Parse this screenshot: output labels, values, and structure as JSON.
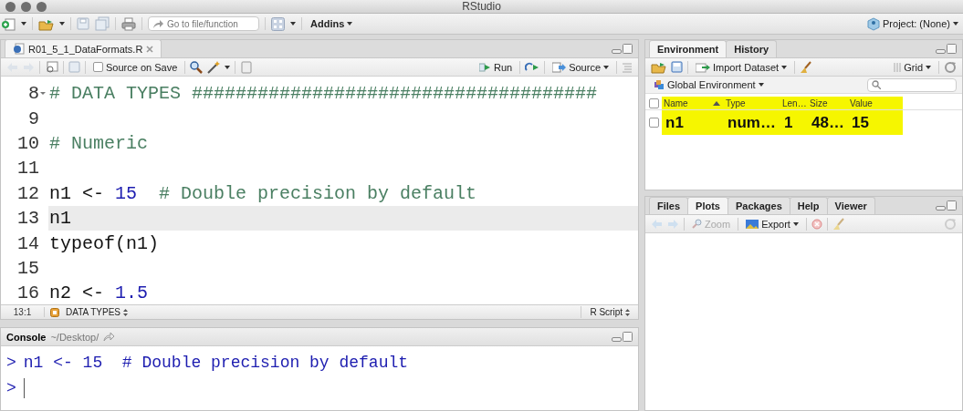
{
  "window": {
    "title": "RStudio"
  },
  "toolbar": {
    "goto_placeholder": "Go to file/function",
    "addins": "Addins",
    "project": "Project: (None)"
  },
  "editor": {
    "tabs": [
      {
        "label": "R01_5_1_DataFormats.R",
        "selected": true
      }
    ],
    "source_on_save": {
      "label": "Source on Save",
      "checked": false
    },
    "run": "Run",
    "source": "Source",
    "lines": [
      {
        "number": "8",
        "fold": true,
        "current": false,
        "tokens": [
          {
            "kind": "comment",
            "text": "# DATA TYPES #####################################"
          }
        ]
      },
      {
        "number": "9",
        "fold": false,
        "current": false
      },
      {
        "number": "10",
        "fold": false,
        "current": false,
        "tokens": [
          {
            "kind": "comment",
            "text": "# Numeric"
          }
        ]
      },
      {
        "number": "11",
        "fold": false,
        "current": false
      },
      {
        "number": "12",
        "fold": false,
        "current": false,
        "tokens": [
          {
            "kind": "plain",
            "text": "n1 <- "
          },
          {
            "kind": "number",
            "text": "15"
          },
          {
            "kind": "comment",
            "text": "  # Double precision by default"
          }
        ]
      },
      {
        "number": "13",
        "fold": false,
        "current": true,
        "tokens": [
          {
            "kind": "plain",
            "text": "n1"
          }
        ]
      },
      {
        "number": "14",
        "fold": false,
        "current": false,
        "tokens": [
          {
            "kind": "plain",
            "text": "typeof(n1)"
          }
        ]
      },
      {
        "number": "15",
        "fold": false,
        "current": false
      },
      {
        "number": "16",
        "fold": false,
        "current": false,
        "tokens": [
          {
            "kind": "plain",
            "text": "n2 <- "
          },
          {
            "kind": "number",
            "text": "1.5"
          }
        ]
      }
    ],
    "status": {
      "position": "13:1",
      "section": "DATA TYPES",
      "file_type": "R Script"
    }
  },
  "environment": {
    "tabs": [
      {
        "label": "Environment",
        "selected": true
      },
      {
        "label": "History",
        "selected": false
      }
    ],
    "import": "Import Dataset",
    "view": "Grid",
    "scope": "Global Environment",
    "highlighted": true,
    "select_all_checked": false,
    "columns": [
      {
        "label": "Name",
        "sorted": true
      },
      {
        "label": "Type",
        "sorted": false
      },
      {
        "label": "Len…",
        "sorted": false
      },
      {
        "label": "Size",
        "sorted": false
      },
      {
        "label": "Value",
        "sorted": false
      }
    ],
    "rows": [
      {
        "checked": false,
        "cells": [
          "n1",
          "num…",
          "1",
          "48…",
          "15"
        ]
      }
    ]
  },
  "files": {
    "tabs": [
      {
        "label": "Files",
        "selected": false
      },
      {
        "label": "Plots",
        "selected": true
      },
      {
        "label": "Packages",
        "selected": false
      },
      {
        "label": "Help",
        "selected": false
      },
      {
        "label": "Viewer",
        "selected": false
      }
    ],
    "zoom": {
      "label": "Zoom",
      "disabled": true
    },
    "export": "Export"
  },
  "console": {
    "title": "Console",
    "path": "~/Desktop/",
    "lines": [
      {
        "prompt": ">",
        "text": "n1 <- 15  # Double precision by default",
        "cursor": false
      },
      {
        "prompt": ">",
        "cursor": true
      }
    ]
  }
}
